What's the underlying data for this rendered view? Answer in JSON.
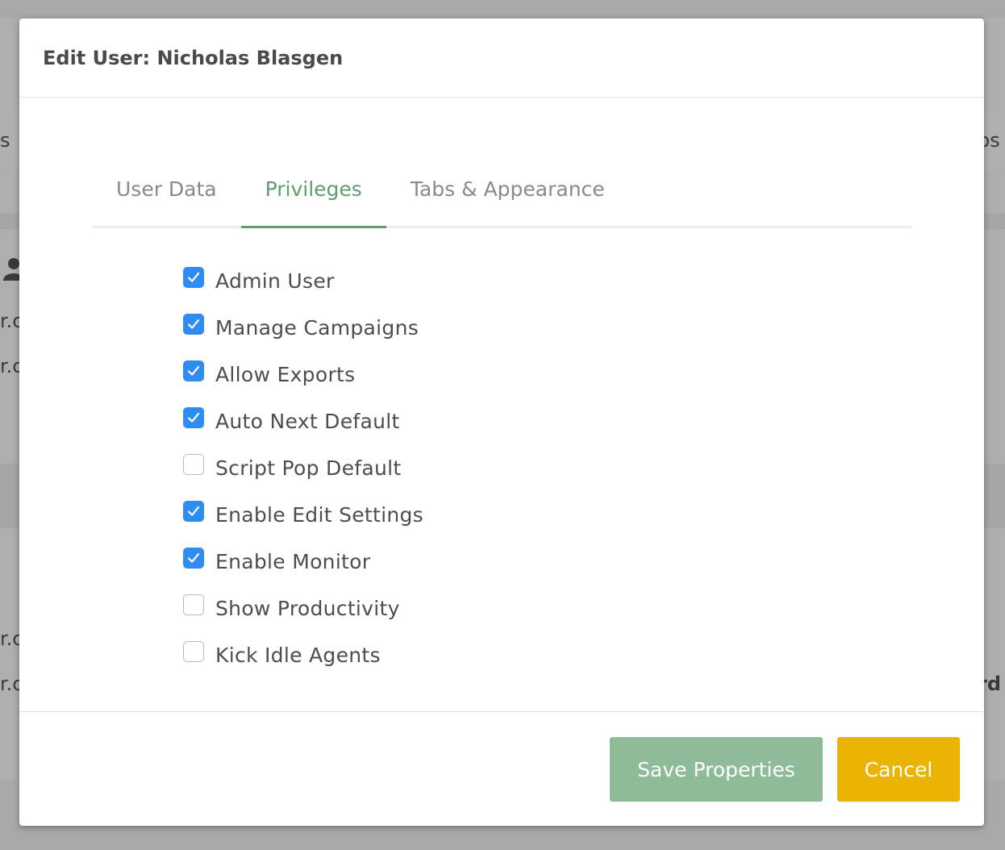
{
  "background": {
    "fragments": [
      "s",
      "ps",
      "r.c",
      "r.c",
      "r.c",
      "r.c",
      "rd"
    ]
  },
  "modal": {
    "title": "Edit User: Nicholas Blasgen",
    "tabs": [
      {
        "label": "User Data",
        "active": false
      },
      {
        "label": "Privileges",
        "active": true
      },
      {
        "label": "Tabs & Appearance",
        "active": false
      }
    ],
    "privileges": [
      {
        "label": "Admin User",
        "checked": true
      },
      {
        "label": "Manage Campaigns",
        "checked": true
      },
      {
        "label": "Allow Exports",
        "checked": true
      },
      {
        "label": "Auto Next Default",
        "checked": true
      },
      {
        "label": "Script Pop Default",
        "checked": false
      },
      {
        "label": "Enable Edit Settings",
        "checked": true
      },
      {
        "label": "Enable Monitor",
        "checked": true
      },
      {
        "label": "Show Productivity",
        "checked": false
      },
      {
        "label": "Kick Idle Agents",
        "checked": false
      }
    ],
    "footer": {
      "save_label": "Save Properties",
      "cancel_label": "Cancel"
    }
  },
  "colors": {
    "accent": "#5e9e6e",
    "checkbox": "#2f8cf0",
    "save_button": "#8fbc98",
    "cancel_button": "#ebb304"
  }
}
